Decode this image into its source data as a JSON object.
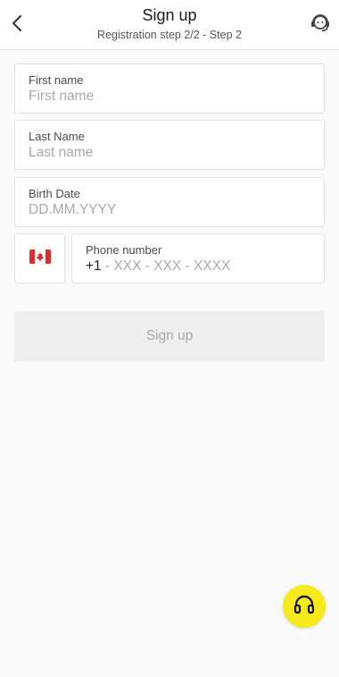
{
  "header": {
    "title": "Sign up",
    "subtitle": "Registration step 2/2 - Step 2",
    "back_icon": "chevron-left-icon",
    "support_icon": "support-agent-icon"
  },
  "form": {
    "first_name": {
      "label": "First name",
      "placeholder": "First name"
    },
    "last_name": {
      "label": "Last Name",
      "placeholder": "Last name"
    },
    "birth_date": {
      "label": "Birth Date",
      "placeholder": "DD.MM.YYYY"
    },
    "phone": {
      "country_flag": "canada-flag-icon",
      "label": "Phone number",
      "prefix": "+1",
      "placeholder": " - XXX - XXX - XXXX"
    }
  },
  "signup_button": {
    "label": "Sign up",
    "enabled": false
  },
  "fab": {
    "icon": "headphones-icon",
    "color": "#f7ea1c"
  },
  "colors": {
    "background": "#fafafa",
    "field_border": "#e2e2e2",
    "placeholder": "#a9a9a9",
    "button_disabled_bg": "#efefef",
    "button_disabled_text": "#a8a8a8",
    "flag_red": "#e32b2b"
  }
}
